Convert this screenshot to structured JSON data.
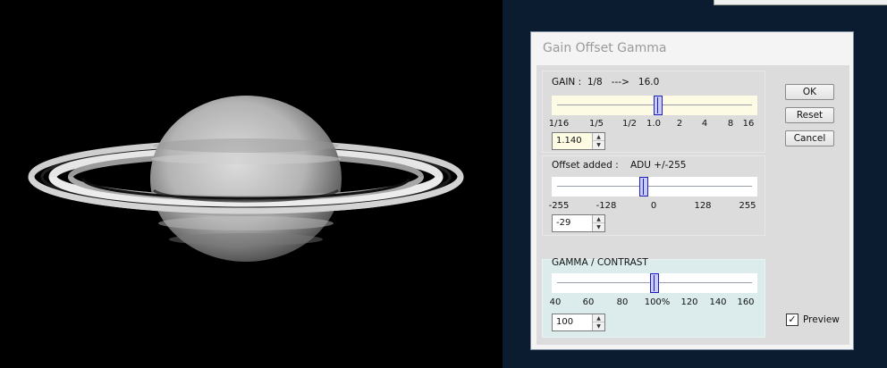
{
  "dialog": {
    "title": "Gain Offset Gamma",
    "gain": {
      "label": "GAIN :  1/8   --->   16.0",
      "ticks": [
        "1/16",
        "1/5",
        "1/2",
        "1.0",
        "2",
        "4",
        "8",
        "16"
      ],
      "value": "1.140",
      "slider_position_fraction": 0.52
    },
    "offset": {
      "label": "Offset added :    ADU +/-255",
      "ticks": [
        "-255",
        "-128",
        "0",
        "128",
        "255"
      ],
      "value": "-29",
      "slider_value": -29,
      "slider_range": [
        -255,
        255
      ]
    },
    "gamma": {
      "label": "GAMMA / CONTRAST",
      "ticks": [
        "40",
        "60",
        "80",
        "100%",
        "120",
        "140",
        "160"
      ],
      "value": "100",
      "slider_value": 100,
      "slider_range": [
        40,
        160
      ]
    },
    "buttons": {
      "ok": "OK",
      "reset": "Reset",
      "cancel": "Cancel"
    },
    "preview": {
      "label": "Preview",
      "checked": true
    }
  },
  "icons": {
    "spin_up": "▲",
    "spin_down": "▼",
    "check": "✓"
  },
  "colors": {
    "gain_slider_bg": "#fdfbe3",
    "gamma_group_bg": "#dcecec",
    "thumb_fill": "#c8ccf8",
    "thumb_border": "#1c1cc0"
  }
}
